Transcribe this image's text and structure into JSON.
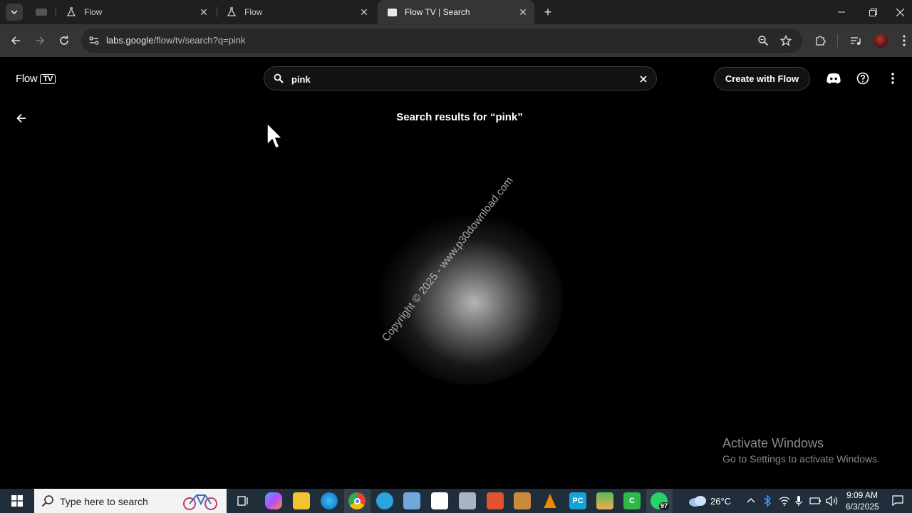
{
  "browser": {
    "tabs": [
      {
        "label": "Flow",
        "active": false
      },
      {
        "label": "Flow",
        "active": false
      },
      {
        "label": "Flow TV | Search",
        "active": true
      }
    ],
    "url_host": "labs.google",
    "url_path": "/flow/tv/search?q=pink"
  },
  "header": {
    "logo_text": "Flow",
    "logo_badge": "TV",
    "search_value": "pink",
    "create_label": "Create with Flow"
  },
  "main": {
    "results_title": "Search results for “pink”",
    "watermark": "Copyright © 2025 - www.p30download.com"
  },
  "windows_notice": {
    "title": "Activate Windows",
    "subtitle": "Go to Settings to activate Windows."
  },
  "taskbar": {
    "search_placeholder": "Type here to search",
    "weather": "26°C",
    "time": "9:09 AM",
    "date": "6/3/2025",
    "whatsapp_badge": "97"
  },
  "colors": {
    "page_bg": "#000000",
    "toolbar_bg": "#353535",
    "tabstrip_bg": "#1f1f1f",
    "taskbar_bg": "#202d3a"
  }
}
